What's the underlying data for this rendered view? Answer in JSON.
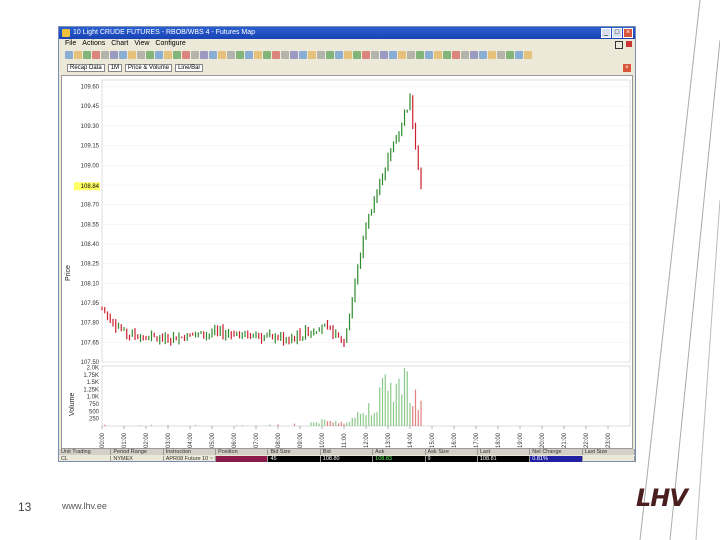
{
  "window": {
    "title": "10 Light CRUDE FUTURES - RBOB/WBS 4 - Futures Map",
    "menu": [
      "File",
      "Actions",
      "Chart",
      "View",
      "Configure"
    ]
  },
  "toolbar2": {
    "dropdowns": [
      "Recap Data",
      "1M",
      "Price & Volume",
      "Line/Bar"
    ]
  },
  "chart": {
    "y_axis_title": "Price",
    "price_ticks": [
      "109.60",
      "109.45",
      "109.30",
      "109.15",
      "109.00",
      "108.85",
      "108.70",
      "108.55",
      "108.40",
      "108.25",
      "108.10",
      "107.95",
      "107.80",
      "107.65",
      "107.50"
    ],
    "current_price_label": "108.84",
    "volume_title": "Volume",
    "volume_ticks": [
      "2.0K",
      "1.75K",
      "1.5K",
      "1.25K",
      "1.0K",
      "750",
      "500",
      "250"
    ],
    "time_ticks": [
      "00:00",
      "01:00",
      "02:00",
      "03:00",
      "04:00",
      "05:00",
      "06:00",
      "07:00",
      "08:00",
      "09:00",
      "10:00",
      "11:00",
      "12:00",
      "13:00",
      "14:00",
      "15:00",
      "16:00",
      "17:00",
      "18:00",
      "19:00",
      "20:00",
      "21:00",
      "22:00",
      "23:00"
    ]
  },
  "chart_data": {
    "type": "bar",
    "title": "",
    "xlabel": "",
    "ylabel": "Price",
    "ylim": [
      107.5,
      109.65
    ],
    "x": [
      "00:00",
      "01:00",
      "02:00",
      "03:00",
      "04:00",
      "05:00",
      "06:00",
      "07:00",
      "08:00",
      "09:00",
      "10:00",
      "11:00",
      "12:00",
      "13:00",
      "14:00",
      "14:30"
    ],
    "series": [
      {
        "values": [
          107.9,
          107.72,
          107.68,
          107.68,
          107.7,
          107.72,
          107.72,
          107.7,
          107.68,
          107.7,
          107.78,
          107.65,
          108.55,
          109.05,
          109.5,
          108.84
        ]
      }
    ],
    "volume": {
      "ylabel": "Volume",
      "ylim": [
        0,
        2050
      ],
      "values": [
        50,
        60,
        40,
        50,
        40,
        30,
        30,
        30,
        60,
        90,
        200,
        180,
        650,
        1700,
        1900,
        900
      ]
    }
  },
  "statusbar": {
    "headers": [
      "Unit Trading",
      "Period Range",
      "Instruction",
      "Position",
      "Bid Size",
      "Bid",
      "Ask",
      "Ask Size",
      "Last",
      "Net Change",
      "Last Size"
    ],
    "values": [
      "CL",
      "NYMEX",
      "APR08 Future 10 ~ 5:00",
      "",
      "45",
      "108.80",
      "108.83",
      "9",
      "108.81",
      "0.81%",
      ""
    ]
  },
  "slide": {
    "number": "13",
    "url": "www.lhv.ee",
    "logo": "LHV"
  },
  "colors": {
    "up": "#2e8b2e",
    "down": "#cc1f2f",
    "volume_up": "#8ac98a",
    "volume_down": "#e08080",
    "highlight": "#ffff66"
  }
}
